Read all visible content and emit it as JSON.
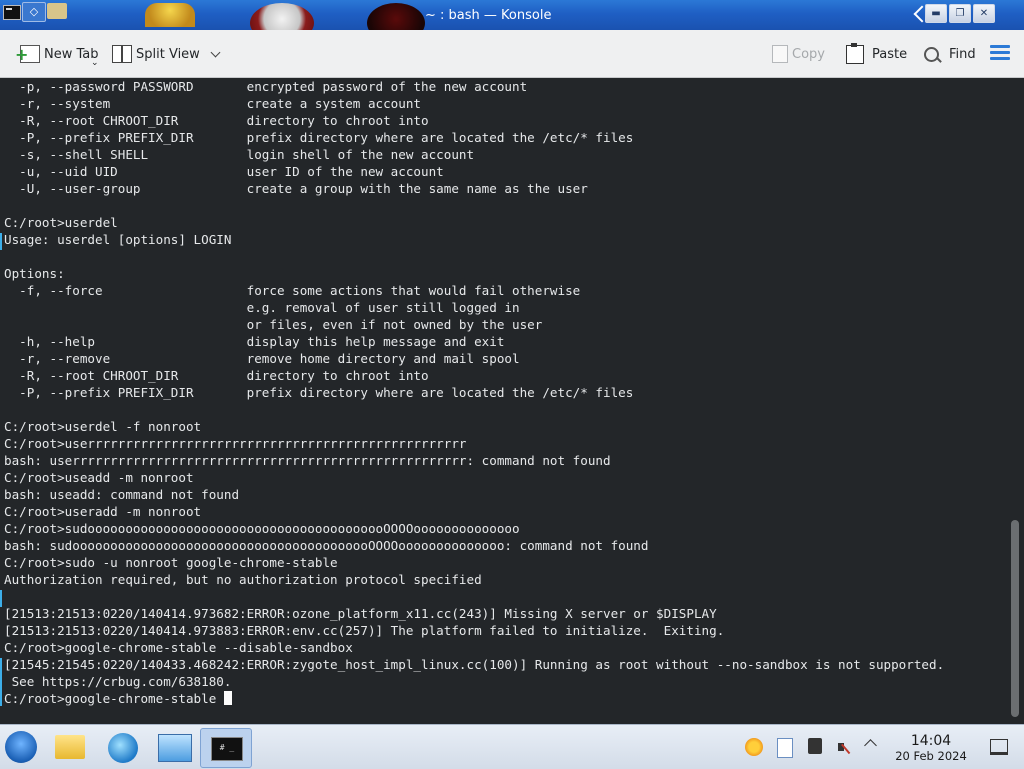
{
  "window": {
    "title": "~ : bash — Konsole",
    "pin_glyph": "◇"
  },
  "toolbar": {
    "new_tab": "New Tab",
    "split_view": "Split View",
    "copy": "Copy",
    "paste": "Paste",
    "find": "Find"
  },
  "terminal": {
    "lines": [
      "  -p, --password PASSWORD       encrypted password of the new account",
      "  -r, --system                  create a system account",
      "  -R, --root CHROOT_DIR         directory to chroot into",
      "  -P, --prefix PREFIX_DIR       prefix directory where are located the /etc/* files",
      "  -s, --shell SHELL             login shell of the new account",
      "  -u, --uid UID                 user ID of the new account",
      "  -U, --user-group              create a group with the same name as the user",
      "",
      "C:/root>userdel",
      "Usage: userdel [options] LOGIN",
      "",
      "Options:",
      "  -f, --force                   force some actions that would fail otherwise",
      "                                e.g. removal of user still logged in",
      "                                or files, even if not owned by the user",
      "  -h, --help                    display this help message and exit",
      "  -r, --remove                  remove home directory and mail spool",
      "  -R, --root CHROOT_DIR         directory to chroot into",
      "  -P, --prefix PREFIX_DIR       prefix directory where are located the /etc/* files",
      "",
      "C:/root>userdel -f nonroot",
      "C:/root>userrrrrrrrrrrrrrrrrrrrrrrrrrrrrrrrrrrrrrrrrrrrrrrrrr",
      "bash: userrrrrrrrrrrrrrrrrrrrrrrrrrrrrrrrrrrrrrrrrrrrrrrrrrrr: command not found",
      "C:/root>useadd -m nonroot",
      "bash: useadd: command not found",
      "C:/root>useradd -m nonroot",
      "C:/root>sudoooooooooooooooooooooooooooooooooooooooOOOOoooooooooooooo",
      "bash: sudoooooooooooooooooooooooooooooooooooooooOOOOoooooooooooooo: command not found",
      "C:/root>sudo -u nonroot google-chrome-stable",
      "Authorization required, but no authorization protocol specified",
      "",
      "[21513:21513:0220/140414.973682:ERROR:ozone_platform_x11.cc(243)] Missing X server or $DISPLAY",
      "[21513:21513:0220/140414.973883:ERROR:env.cc(257)] The platform failed to initialize.  Exiting.",
      "C:/root>google-chrome-stable --disable-sandbox",
      "[21545:21545:0220/140433.468242:ERROR:zygote_host_impl_linux.cc(100)] Running as root without --no-sandbox is not supported.",
      " See https://crbug.com/638180."
    ],
    "prompt_line": "C:/root>google-chrome-stable "
  },
  "taskbar": {
    "terminal_icon_text": "# _",
    "clock_time": "14:04",
    "clock_date": "20 Feb 2024"
  },
  "colors": {
    "terminal_bg": "#232629",
    "terminal_fg": "#e6e8ea",
    "accent": "#3daee9",
    "titlebar": "#1f5fc4"
  }
}
